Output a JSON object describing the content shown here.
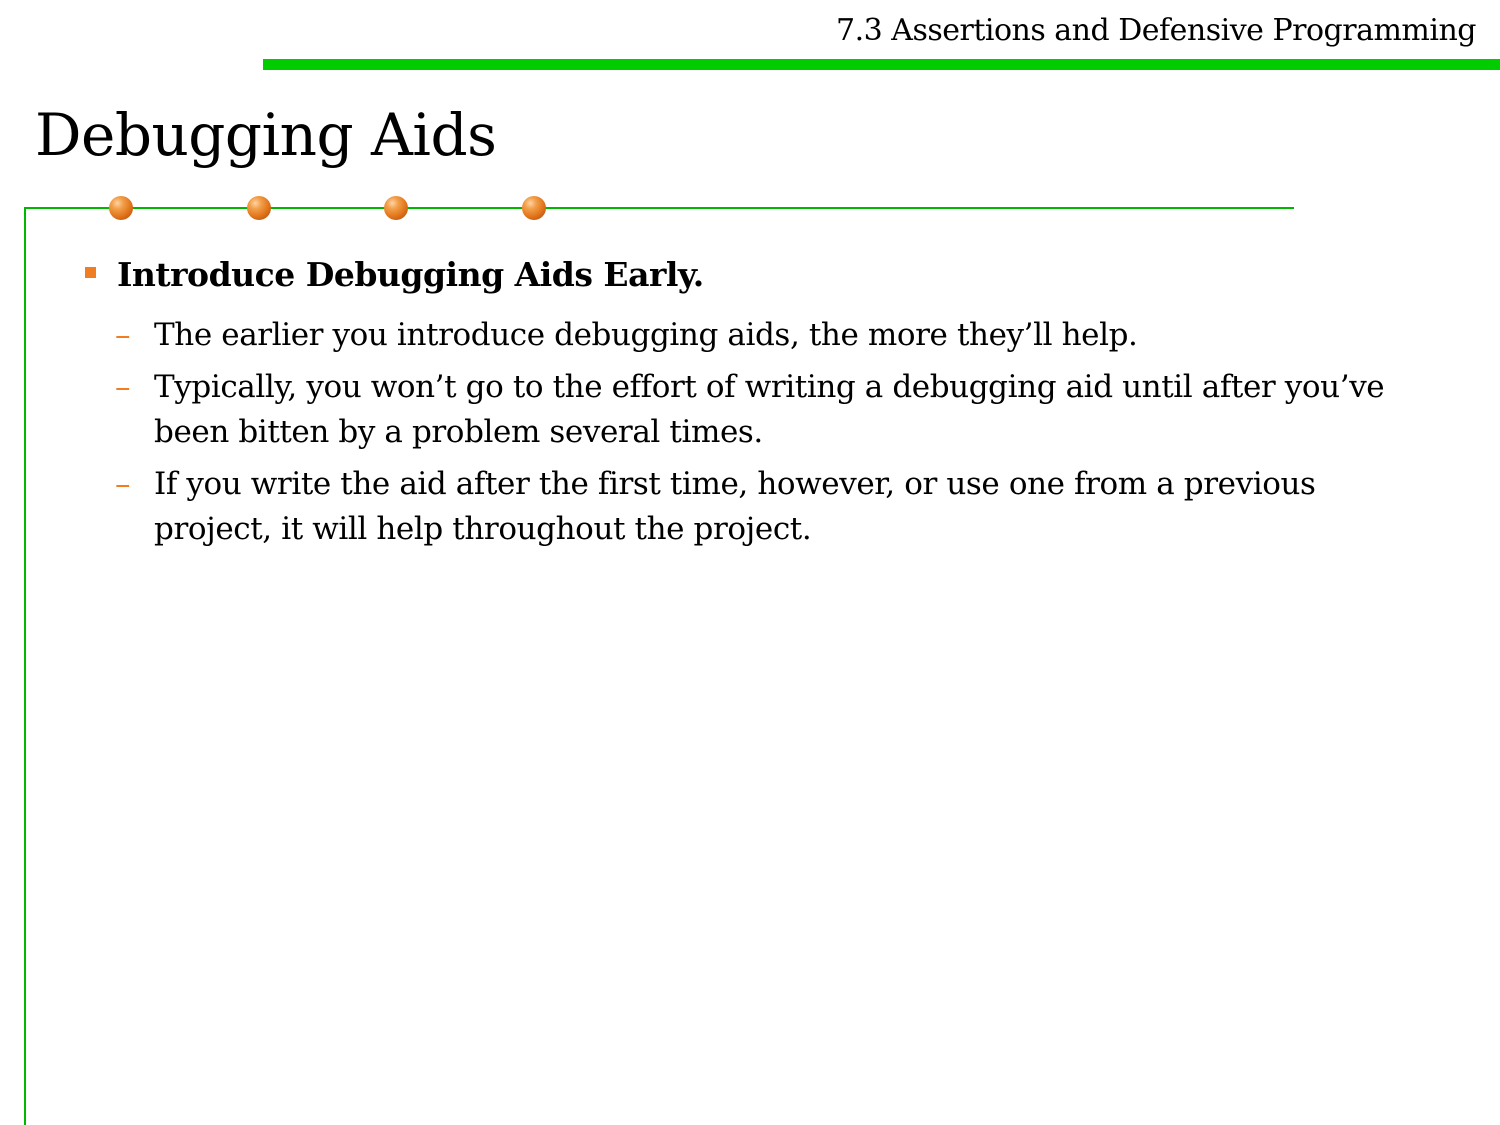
{
  "header": {
    "section_title": "7.3 Assertions and Defensive Programming",
    "rule_color": "#00cc00"
  },
  "slide": {
    "title": "Debugging Aids",
    "accent_color": "#f07d21",
    "rule_color": "#00b800"
  },
  "content": {
    "bullet": {
      "text": "Introduce Debugging Aids Early.",
      "icon": "square-bullet-icon"
    },
    "subitems": [
      {
        "dash": "–",
        "text": "The earlier you introduce debugging aids, the more they’ll help."
      },
      {
        "dash": "–",
        "text": "Typically, you won’t go to the effort of writing a debugging aid until after you’ve been bitten by a problem several times."
      },
      {
        "dash": "–",
        "text": "If you write the aid after the first time, however, or use one from a previous project, it will help throughout the project."
      }
    ]
  }
}
